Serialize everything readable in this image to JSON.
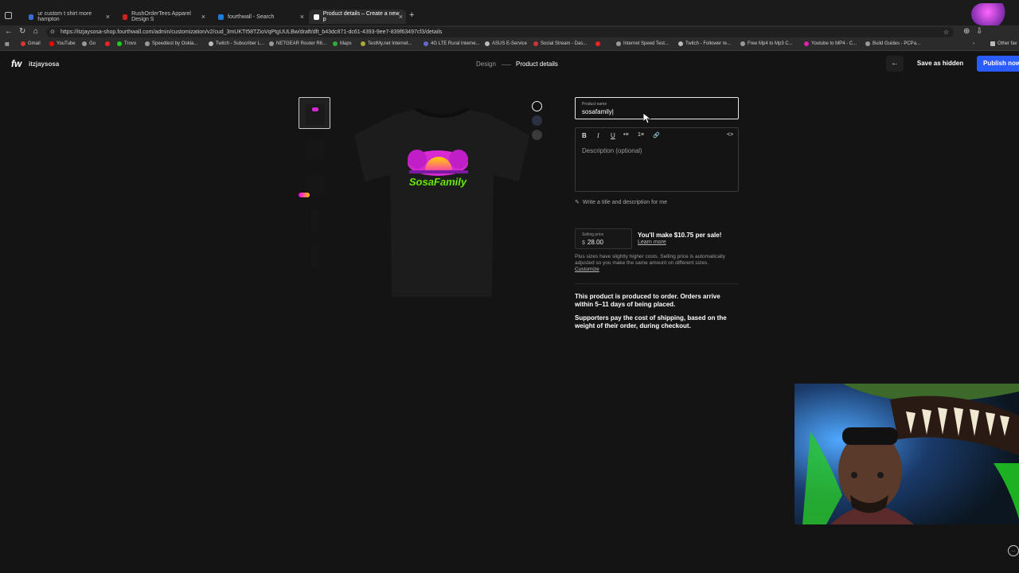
{
  "browser": {
    "tabs": [
      {
        "title": "ur custom t shirt more hampton"
      },
      {
        "title": "RushOrderTees Apparel Design S"
      },
      {
        "title": "fourthwall - Search"
      },
      {
        "title": "Product details – Create a new p"
      }
    ],
    "new_tab": "+",
    "url": "https://itzjaysosa-shop.fourthwall.com/admin/customization/v2/cud_3mUKTt58TZioVqPtgUULBw/draft/dft_b43dc871-dc61-4393-9ee7-839f63497cf3/details",
    "bookmarks": [
      "Gmail",
      "YouTube",
      "Go",
      "Trovo",
      "Speedtest by Ookla...",
      "Twitch - Subscriber L...",
      "NETGEAR Router R6...",
      "Maps",
      "TestMy.net Internet...",
      "4G LTE Rural Interne...",
      "ASUS E-Service",
      "Social Stream - Das...",
      "Internet Speed Test...",
      "Twitch - Follower re...",
      "Free Mp4 to Mp3 C...",
      "Youtube to MP4 - C...",
      "Build Guides - PCPa...",
      "Other fav"
    ]
  },
  "header": {
    "logo": "fw",
    "shop_name": "itzjaysosa",
    "steps": [
      "Design",
      "Product details"
    ],
    "back": "←",
    "save_hidden": "Save as hidden",
    "publish": "Publish now"
  },
  "product": {
    "print_text": "SosaFamily",
    "colors": [
      "#111111",
      "#2b3142",
      "#3a3a3a"
    ]
  },
  "form": {
    "name_label": "Product name",
    "name_value": "sosafamily|",
    "toolbar": [
      "B",
      "I",
      "U",
      "•≡",
      "1≡",
      "🔗",
      "<>"
    ],
    "description_placeholder": "Description (optional)",
    "ai_link": "Write a title and description for me",
    "price_label": "Selling price",
    "currency": "$",
    "price_value": "28.00",
    "earn_text": "You'll make $10.75 per sale!",
    "learn_more": "Learn more",
    "plus_note": "Plus sizes have slightly higher costs. Selling price is automatically adjusted so you make the same amount on different sizes.",
    "customize": "Customize",
    "info1": "This product is produced to order. Orders arrive within 5–11 days of being placed.",
    "info2": "Supporters pay the cost of shipping, based on the weight of their order, during checkout."
  },
  "overlay": {
    "brand_text": "SosaFamily"
  }
}
